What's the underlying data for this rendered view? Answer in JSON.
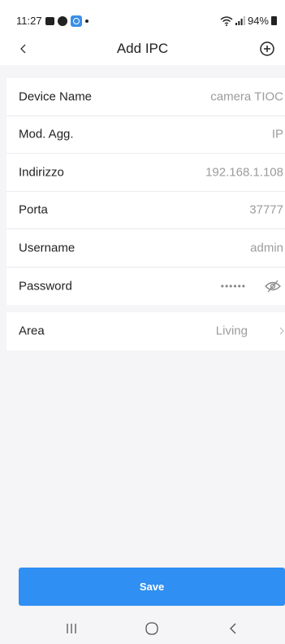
{
  "status_bar": {
    "time": "11:27",
    "battery": "94%"
  },
  "header": {
    "title": "Add IPC"
  },
  "form": {
    "rows": [
      {
        "label": "Device Name",
        "value": "camera TIOC"
      },
      {
        "label": "Mod. Agg.",
        "value": "IP"
      },
      {
        "label": "Indirizzo",
        "value": "192.168.1.108"
      },
      {
        "label": "Porta",
        "value": "37777"
      },
      {
        "label": "Username",
        "value": "admin"
      },
      {
        "label": "Password",
        "value": "••••••"
      }
    ],
    "area": {
      "label": "Area",
      "value": "Living"
    }
  },
  "actions": {
    "save_label": "Save"
  },
  "colors": {
    "accent": "#2f8ff2",
    "background": "#f5f4f6",
    "value_text": "#9c9c9c"
  },
  "icons": [
    "back-arrow-icon",
    "add-circle-icon",
    "eye-hidden-icon",
    "chevron-right-icon",
    "recents-icon",
    "home-icon",
    "nav-back-icon"
  ]
}
